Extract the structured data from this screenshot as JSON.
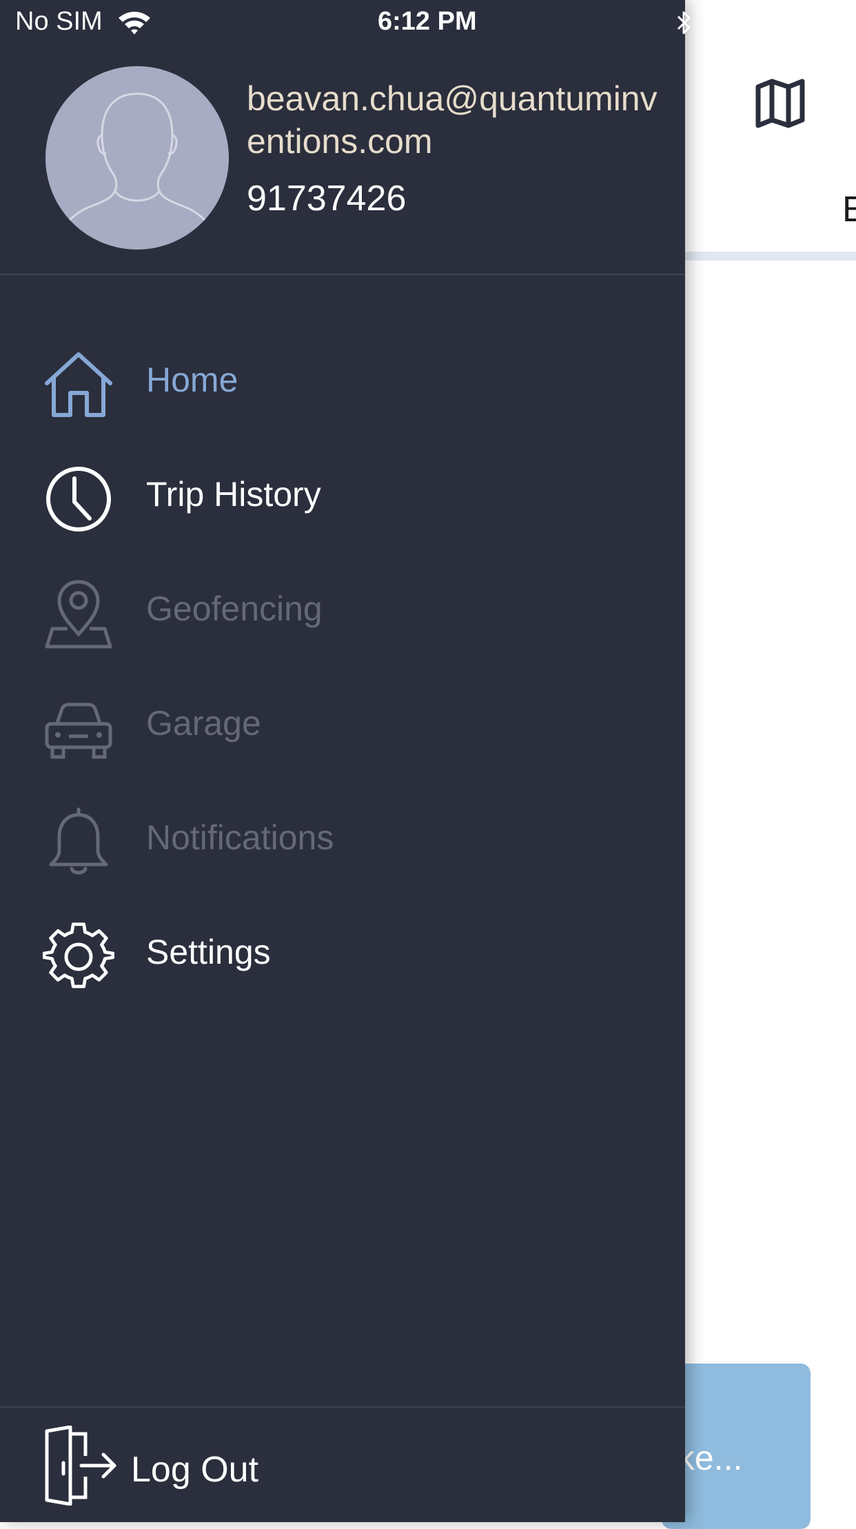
{
  "status_bar": {
    "carrier": "No SIM",
    "time": "6:12 PM",
    "icons": [
      "wifi-icon",
      "bluetooth-icon"
    ]
  },
  "profile": {
    "email": "beavan.chua@quantuminventions.com",
    "phone": "91737426",
    "avatar_icon": "user-silhouette-icon"
  },
  "menu": {
    "items": [
      {
        "label": "Home",
        "icon": "home-icon",
        "state": "active"
      },
      {
        "label": "Trip History",
        "icon": "clock-icon",
        "state": "enabled"
      },
      {
        "label": "Geofencing",
        "icon": "map-pin-icon",
        "state": "disabled"
      },
      {
        "label": "Garage",
        "icon": "car-icon",
        "state": "disabled"
      },
      {
        "label": "Notifications",
        "icon": "bell-icon",
        "state": "disabled"
      },
      {
        "label": "Settings",
        "icon": "gear-icon",
        "state": "enabled"
      }
    ],
    "logout_label": "Log Out",
    "logout_icon": "logout-door-icon"
  },
  "background": {
    "map_icon": "map-icon",
    "tab_fragment": "E",
    "toast_text_fragment": "s ke..."
  },
  "colors": {
    "drawer_bg": "#2b2e3c",
    "active": "#86a8d6",
    "disabled": "#646878",
    "email": "#e6dccb",
    "toast": "#8fbbde"
  }
}
